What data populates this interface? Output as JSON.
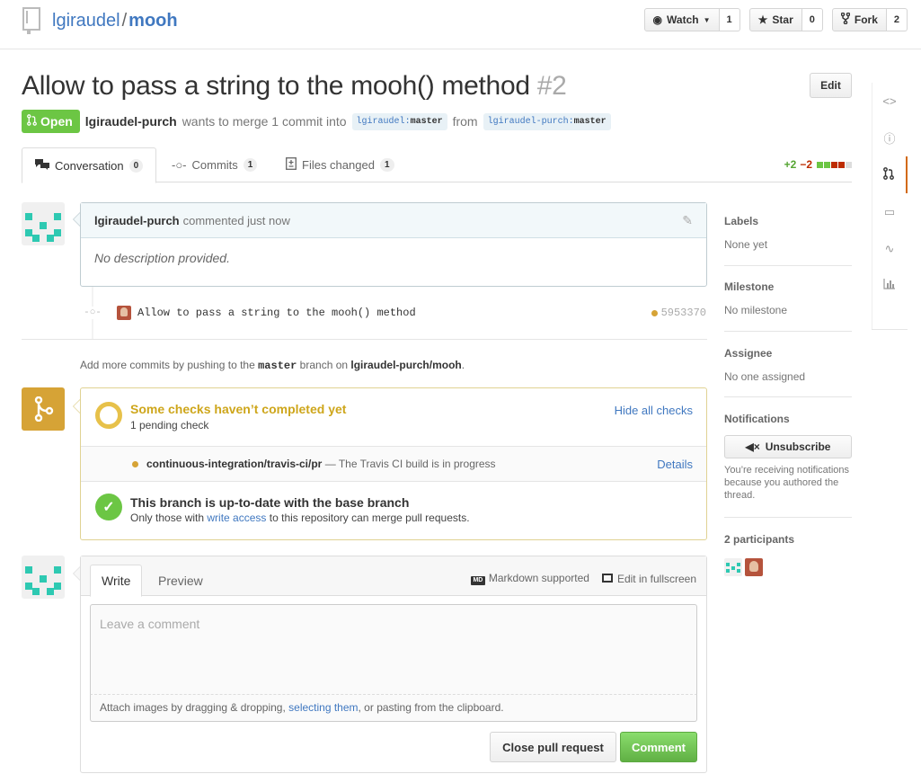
{
  "repo": {
    "owner": "lgiraudel",
    "separator": "/",
    "name": "mooh"
  },
  "repo_actions": {
    "watch_label": "Watch",
    "watch_count": "1",
    "star_label": "Star",
    "star_count": "0",
    "fork_label": "Fork",
    "fork_count": "2"
  },
  "pr": {
    "title": "Allow to pass a string to the mooh() method",
    "number": "#2",
    "edit_label": "Edit",
    "state": "Open",
    "author": "lgiraudel-purch",
    "merge_text": "wants to merge 1 commit into",
    "base_owner": "lgiraudel",
    "base_branch": "master",
    "from_text": "from",
    "head_owner": "lgiraudel-purch",
    "head_branch": "master"
  },
  "tabs": [
    {
      "label": "Conversation",
      "count": "0"
    },
    {
      "label": "Commits",
      "count": "1"
    },
    {
      "label": "Files changed",
      "count": "1"
    }
  ],
  "diffstat": {
    "additions": "+2",
    "deletions": "−2"
  },
  "comment": {
    "author": "lgiraudel-purch",
    "action": "commented just now",
    "body": "No description provided."
  },
  "commit": {
    "message": "Allow to pass a string to the mooh() method",
    "sha": "5953370"
  },
  "push_hint": {
    "prefix": "Add more commits by pushing to the",
    "branch": "master",
    "middle": "branch on",
    "repo": "lgiraudel-purch/mooh",
    "suffix": "."
  },
  "checks": {
    "title": "Some checks haven’t completed yet",
    "subtitle": "1 pending check",
    "hide_label": "Hide all checks",
    "check_name": "continuous-integration/travis-ci/pr",
    "check_desc": "— The Travis CI build is in progress",
    "details_label": "Details",
    "status_title": "This branch is up-to-date with the base branch",
    "status_pre": "Only those with",
    "status_link": "write access",
    "status_post": "to this repository can merge pull requests."
  },
  "new_comment": {
    "write_tab": "Write",
    "preview_tab": "Preview",
    "markdown_label": "Markdown supported",
    "fullscreen_label": "Edit in fullscreen",
    "placeholder": "Leave a comment",
    "attach_pre": "Attach images by dragging & dropping,",
    "attach_link": "selecting them",
    "attach_post": ", or pasting from the clipboard.",
    "close_label": "Close pull request",
    "comment_label": "Comment"
  },
  "sidebar": {
    "labels_h": "Labels",
    "labels_v": "None yet",
    "milestone_h": "Milestone",
    "milestone_v": "No milestone",
    "assignee_h": "Assignee",
    "assignee_v": "No one assigned",
    "notifications_h": "Notifications",
    "unsubscribe_label": "Unsubscribe",
    "notifications_note": "You’re receiving notifications because you authored the thread.",
    "participants_h": "2 participants"
  },
  "colors": {
    "accent": "#4078c0",
    "open": "#6cc644",
    "pending": "#cea61b",
    "nav_selected": "#d26911"
  },
  "repo_nav_icons": [
    "code-icon",
    "issues-icon",
    "pull-request-icon",
    "wiki-icon",
    "pulse-icon",
    "graphs-icon"
  ]
}
